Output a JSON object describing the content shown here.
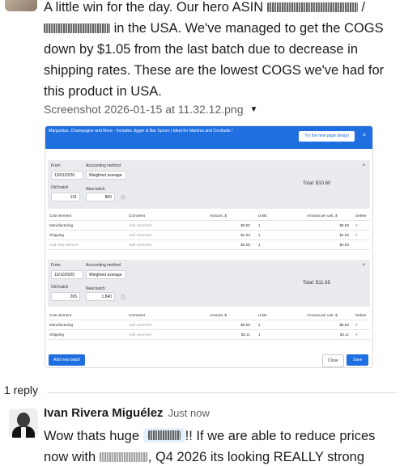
{
  "message": {
    "line1_a": "A little win for the day. Our hero ASIN",
    "line1_b": "/",
    "line2_a": "in the USA. We've managed to get the COGS",
    "line3": "down by $1.05 from the last batch due to decrease in",
    "line4": "shipping rates. These are the lowest COGS we've had for",
    "line5": "this product in USA."
  },
  "file": {
    "name": "Screenshot 2026-01-15 at 11.32.12.png"
  },
  "screenshot": {
    "header_text": "Margaritas, Champagne and More - Includes Jigger & Bar Spoon | Ideal for Martinis and Cocktails /",
    "try_button": "Try the new page design",
    "close_x": "×",
    "labels": {
      "from": "From",
      "accounting_method": "Accounting method",
      "old_batch": "Old batch",
      "new_batch": "New batch"
    },
    "columns": [
      "Cost element",
      "Comment",
      "Amount, $",
      "Units",
      "Amount per unit, $",
      "Delete"
    ],
    "comment_placeholder": "Add comment",
    "add_cost_placeholder": "Add cost element",
    "batch1": {
      "from": "13/01/2026",
      "method": "Weighted average",
      "old_batch": "131",
      "new_batch": "800",
      "total": "Total: $10.60",
      "rows": [
        {
          "element": "Manufacturing",
          "amount": "$8.50",
          "units": "1",
          "per_unit": "$8.50"
        },
        {
          "element": "Shipping",
          "amount": "$1.93",
          "units": "1",
          "per_unit": "$1.93"
        }
      ],
      "empty_amount": "$0.00",
      "empty_units": "1",
      "empty_per_unit": "$0.00"
    },
    "batch2": {
      "from": "15/10/2025",
      "method": "Weighted average",
      "old_batch": "265",
      "new_batch": "1,840",
      "total": "Total: $11.65",
      "rows": [
        {
          "element": "Manufacturing",
          "amount": "$8.50",
          "units": "1",
          "per_unit": "$8.50"
        },
        {
          "element": "Shipping",
          "amount": "$3.11",
          "units": "1",
          "per_unit": "$3.11"
        }
      ]
    },
    "buttons": {
      "add_batch": "Add new batch",
      "close": "Close",
      "save": "Save"
    }
  },
  "thread": {
    "reply_count": "1 reply"
  },
  "reply": {
    "name": "Ivan Rivera Miguélez",
    "time": "Just now",
    "text_a": "Wow thats huge",
    "text_b": "!! If we are able to reduce prices",
    "text_c": "now with",
    "text_d": ", Q4 2026 its looking REALLY strong"
  }
}
